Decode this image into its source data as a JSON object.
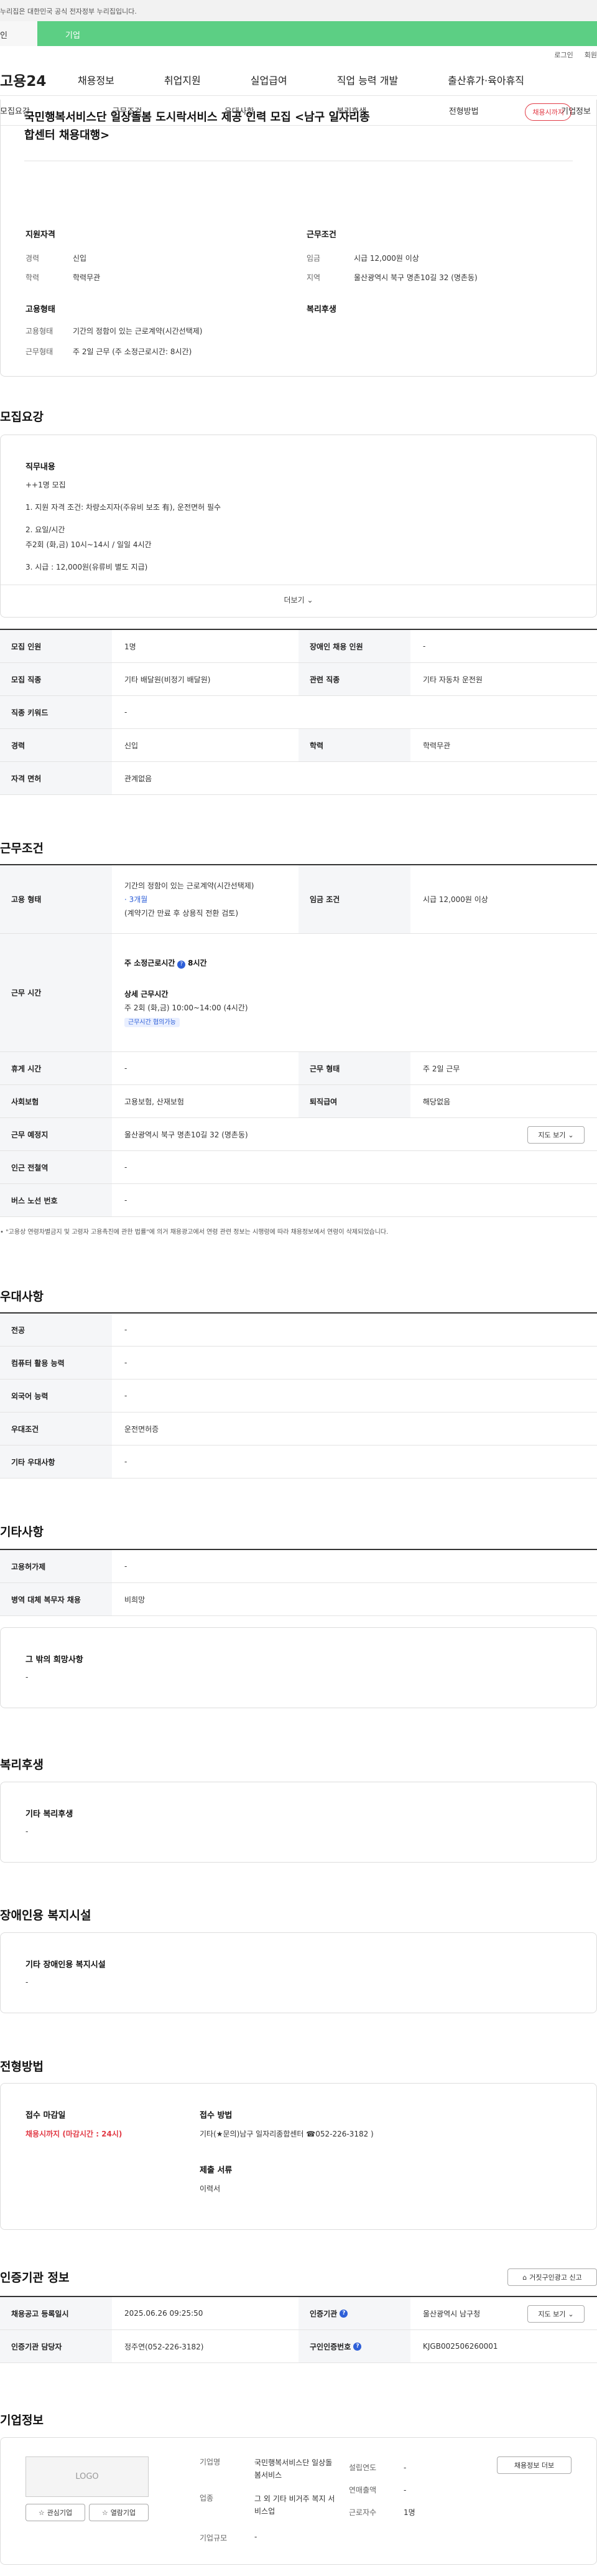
{
  "gov_banner": "누리집은 대한민국 공식 전자정부 누리집입니다.",
  "top_tabs": [
    "인",
    "기업"
  ],
  "util_links": [
    "로그인",
    "회원"
  ],
  "logo": "고용24",
  "gnb": [
    "채용정보",
    "취업지원",
    "실업급여",
    "직업 능력 개발",
    "출산휴가·육아휴직"
  ],
  "lnb": [
    "모집요강",
    "근무조건",
    "우대사항",
    "복리후생",
    "전형방법",
    "기업정보"
  ],
  "job": {
    "title_line1": "국민행복서비스단 일상돌봄 도시락서비스 제공 인력 모집 <남구 일자리종",
    "title_line2": "합센터 채용대행>",
    "status_badge": "채용시까지",
    "qual_title": "지원자격",
    "qual": [
      {
        "k": "경력",
        "v": "신입"
      },
      {
        "k": "학력",
        "v": "학력무관"
      }
    ],
    "cond_title": "근무조건",
    "cond": [
      {
        "k": "임금",
        "v": "시급 12,000원 이상"
      },
      {
        "k": "지역",
        "v": "울산광역시 북구 명촌10길 32 (명촌동)"
      }
    ],
    "emp_title": "고용형태",
    "emp": [
      {
        "k": "고용형태",
        "v": "기간의 정함이 있는 근로계약(시간선택제)"
      },
      {
        "k": "근무형태",
        "v": "주 2일 근무 (주 소정근로시간: 8시간)"
      }
    ],
    "welfare_title": "복리후생"
  },
  "recruit": {
    "title": "모집요강",
    "duty_title": "직무내용",
    "lines": [
      "++1명 모집",
      "1. 지원 자격 조건: 차량소지자(주유비 보조 有),  운전면허  필수",
      "2. 요일/시간",
      "주2회 (화,금) 10시~14시 / 일일 4시간",
      "3. 시급 : 12,000원(유류비 별도 지급)"
    ],
    "more": "더보기",
    "rows": [
      {
        "k1": "모집 인원",
        "v1": "1명",
        "k2": "장애인 채용 인원",
        "v2": "-"
      },
      {
        "k1": "모집 직종",
        "v1": "기타 배달원(비정기 배달원)",
        "k2": "관련 직종",
        "v2": "기타 자동차 운전원"
      },
      {
        "k1": "직종 키워드",
        "v1": "-"
      },
      {
        "k1": "경력",
        "v1": "신입",
        "k2": "학력",
        "v2": "학력무관"
      },
      {
        "k1": "자격 면허",
        "v1": "관계없음"
      }
    ]
  },
  "work": {
    "title": "근무조건",
    "emp_k": "고용 형태",
    "emp_v1": "기간의 정함이 있는 근로계약(시간선택제)",
    "emp_v2": "· 3개월",
    "emp_v3": "(계약기간 만료 후 상용직 전환 검토)",
    "wage_k": "임금 조건",
    "wage_v": "시급 12,000원 이상",
    "time_k": "근무 시간",
    "time_main": "주 소정근로시간",
    "time_hours": "8시간",
    "time_detail_t": "상세 근무시간",
    "time_detail": "주 2회 (화,금)  10:00~14:00 (4시간)",
    "time_badge": "근무시간 협의가능",
    "rows": [
      {
        "k1": "휴게 시간",
        "v1": "-",
        "k2": "근무 형태",
        "v2": "주 2일 근무"
      },
      {
        "k1": "사회보험",
        "v1": "고용보험, 산재보험",
        "k2": "퇴직급여",
        "v2": "해당없음"
      },
      {
        "k1": "근무 예정지",
        "v1": "울산광역시 북구 명촌10길 32 (명촌동)",
        "btn": "지도 보기"
      },
      {
        "k1": "인근 전철역",
        "v1": "-"
      },
      {
        "k1": "버스 노선 번호",
        "v1": "-"
      }
    ],
    "note": "\"고용상 연령차별금지 및 고령자 고용촉진에 관한 법률\"에 의거 채용광고에서 연령 관련 정보는 시행령에 따라 채용정보에서 연령이 삭제되었습니다."
  },
  "pref": {
    "title": "우대사항",
    "rows": [
      {
        "k": "전공",
        "v": "-"
      },
      {
        "k": "컴퓨터 활용 능력",
        "v": "-"
      },
      {
        "k": "외국어 능력",
        "v": "-"
      },
      {
        "k": "우대조건",
        "v": "운전면허증"
      },
      {
        "k": "기타 우대사항",
        "v": "-"
      }
    ]
  },
  "etc": {
    "title": "기타사항",
    "rows": [
      {
        "k": "고용허가제",
        "v": "-"
      },
      {
        "k": "병역 대체 복무자 채용",
        "v": "비희망"
      }
    ],
    "hope_t": "그 밖의 희망사항",
    "hope_v": "-"
  },
  "welfare": {
    "title": "복리후생",
    "t": "기타 복리후생",
    "v": "-"
  },
  "disabled": {
    "title": "장애인용 복지시설",
    "t": "기타 장애인용 복지시설",
    "v": "-"
  },
  "select": {
    "title": "전형방법",
    "deadline_t": "접수 마감일",
    "deadline_v": "채용시까지 (마감시간 : 24시)",
    "method_t": "접수 방법",
    "method_v": "기타(★문의)남구 일자리종합센터 ☎052-226-3182 )",
    "docs_t": "제출 서류",
    "docs_v": "이력서"
  },
  "cert": {
    "title": "인증기관 정보",
    "report_btn": "거짓구인광고 신고",
    "rows": [
      {
        "k1": "채용공고 등록일시",
        "v1": "2025.06.26 09:25:50",
        "k2": "인증기관",
        "v2": "울산광역시 남구청",
        "btn": "지도 보기"
      },
      {
        "k1": "인증기관 담당자",
        "v1": "정주연(052-226-3182)",
        "k2": "구인인증번호",
        "v2": "KJGB002506260001"
      }
    ]
  },
  "company": {
    "title": "기업정보",
    "logo_text": "LOGO",
    "fav_btn": "관심기업",
    "noti_btn": "열람기업",
    "rows": [
      {
        "k": "기업명",
        "v": "국민행복서비스단 일상돌봄서비스"
      },
      {
        "k": "업종",
        "v": "그 외 기타 비거주 복지 서비스업"
      },
      {
        "k": "기업규모",
        "v": "-"
      }
    ],
    "rows2": [
      {
        "k": "설립연도",
        "v": "-"
      },
      {
        "k": "연매출액",
        "v": "-"
      },
      {
        "k": "근로자수",
        "v": "1명"
      }
    ],
    "more_btn": "채용정보 더보"
  }
}
